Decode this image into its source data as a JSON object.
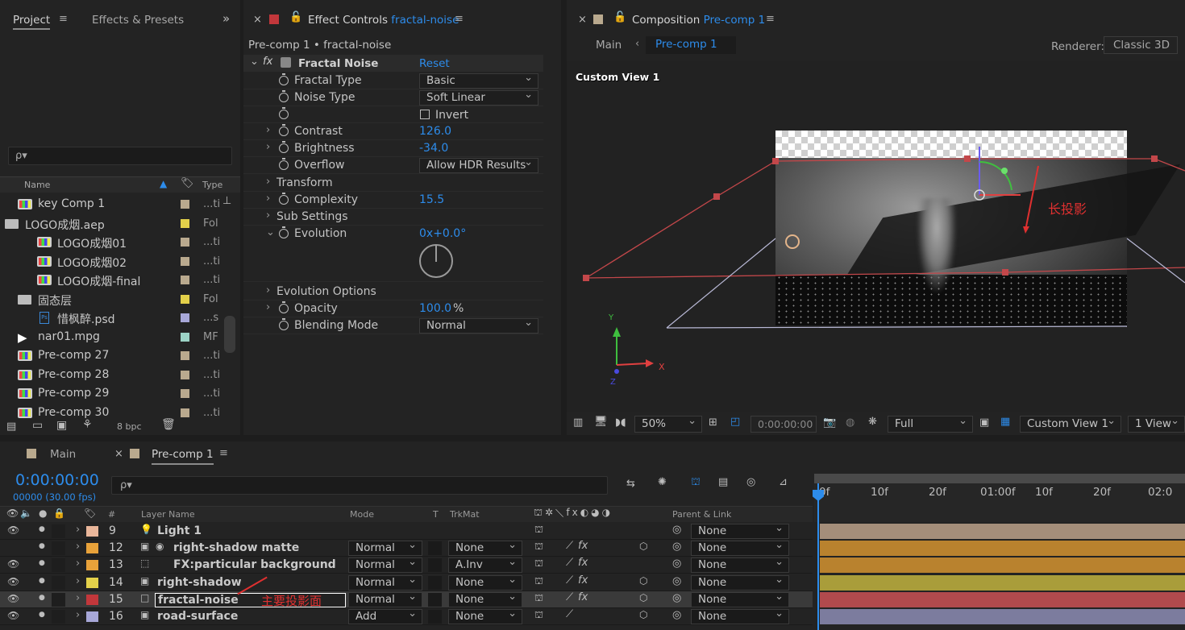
{
  "project": {
    "tabs": [
      "Project",
      "Effects & Presets"
    ],
    "search_placeholder": "ρ▾",
    "columns": {
      "name": "Name",
      "type": "Type"
    },
    "items": [
      {
        "name": "key Comp 1",
        "type": "...ti",
        "color": "#b9a98e",
        "icon": "comp"
      },
      {
        "name": "LOGO成烟.aep",
        "type": "Fol",
        "color": "#e3d04a",
        "icon": "folder"
      },
      {
        "name": "LOGO成烟01",
        "type": "...ti",
        "color": "#b9a98e",
        "icon": "comp"
      },
      {
        "name": "LOGO成烟02",
        "type": "...ti",
        "color": "#b9a98e",
        "icon": "comp"
      },
      {
        "name": "LOGO成烟-final",
        "type": "...ti",
        "color": "#b9a98e",
        "icon": "comp"
      },
      {
        "name": "固态层",
        "type": "Fol",
        "color": "#e3d04a",
        "icon": "folder"
      },
      {
        "name": "惜枫醉.psd",
        "type": "...s",
        "color": "#a7a7d8",
        "icon": "psd"
      },
      {
        "name": "nar01.mpg",
        "type": "MF",
        "color": "#9cd3c6",
        "icon": "video"
      },
      {
        "name": "Pre-comp 27",
        "type": "...ti",
        "color": "#b9a98e",
        "icon": "comp"
      },
      {
        "name": "Pre-comp 28",
        "type": "...ti",
        "color": "#b9a98e",
        "icon": "comp"
      },
      {
        "name": "Pre-comp 29",
        "type": "...ti",
        "color": "#b9a98e",
        "icon": "comp"
      },
      {
        "name": "Pre-comp 30",
        "type": "...ti",
        "color": "#b9a98e",
        "icon": "comp"
      }
    ],
    "bpc": "8 bpc"
  },
  "effect_controls": {
    "tab_label": "Effect Controls",
    "layer": "fractal-noise",
    "breadcrumb": "Pre-comp 1 • fractal-noise",
    "effect_name": "Fractal Noise",
    "reset": "Reset",
    "props": [
      {
        "label": "Fractal Type",
        "value": "Basic",
        "kind": "dropdown"
      },
      {
        "label": "Noise Type",
        "value": "Soft Linear",
        "kind": "dropdown"
      },
      {
        "label": "",
        "value": "Invert",
        "kind": "checkbox"
      },
      {
        "label": "Contrast",
        "value": "126.0",
        "kind": "number"
      },
      {
        "label": "Brightness",
        "value": "-34.0",
        "kind": "number"
      },
      {
        "label": "Overflow",
        "value": "Allow HDR Results",
        "kind": "dropdown"
      },
      {
        "label": "Transform",
        "value": "",
        "kind": "group"
      },
      {
        "label": "Complexity",
        "value": "15.5",
        "kind": "number"
      },
      {
        "label": "Sub Settings",
        "value": "",
        "kind": "group"
      },
      {
        "label": "Evolution",
        "value": "0x+0.0°",
        "kind": "number"
      },
      {
        "label": "Evolution Options",
        "value": "",
        "kind": "group"
      },
      {
        "label": "Opacity",
        "value": "100.0",
        "unit": "%",
        "kind": "number"
      },
      {
        "label": "Blending Mode",
        "value": "Normal",
        "kind": "dropdown"
      }
    ]
  },
  "composition": {
    "tab_label": "Composition",
    "comp": "Pre-comp 1",
    "crumbs": [
      "Main",
      "Pre-comp 1"
    ],
    "renderer_label": "Renderer:",
    "renderer": "Classic 3D",
    "view_label": "Custom View 1",
    "annotation": "长投影",
    "axis_x": "X",
    "axis_y": "Y",
    "axis_z": "Z",
    "footer": {
      "zoom": "50%",
      "timecode": "0:00:00:00",
      "resolution": "Full",
      "view": "Custom View 1",
      "layout": "1 View"
    }
  },
  "timeline": {
    "tabs": [
      "Main",
      "Pre-comp 1"
    ],
    "timecode": "0:00:00:00",
    "fps": "00000 (30.00 fps)",
    "search_placeholder": "ρ▾",
    "headers": {
      "num": "#",
      "layer_name": "Layer Name",
      "mode": "Mode",
      "t": "T",
      "trkmat": "TrkMat",
      "parent": "Parent & Link"
    },
    "ruler": [
      "0f",
      "10f",
      "20f",
      "01:00f",
      "10f",
      "20f",
      "02:0"
    ],
    "annotation": "主要投影面",
    "layers": [
      {
        "num": "9",
        "name": "Light 1",
        "mode": "",
        "trkmat": "",
        "parent": "None",
        "label": "#e9b69a",
        "bar": "#a48e7a",
        "eye": true
      },
      {
        "num": "12",
        "name": "right-shadow matte",
        "mode": "Normal",
        "trkmat": "None",
        "parent": "None",
        "label": "#e8a23a",
        "bar": "#b9822e",
        "eye": false
      },
      {
        "num": "13",
        "name": "FX:particular background",
        "mode": "Normal",
        "trkmat": "A.Inv",
        "parent": "None",
        "label": "#e8a23a",
        "bar": "#b9822e",
        "eye": true
      },
      {
        "num": "14",
        "name": "right-shadow",
        "mode": "Normal",
        "trkmat": "None",
        "parent": "None",
        "label": "#e3d04a",
        "bar": "#a99d3a",
        "eye": true
      },
      {
        "num": "15",
        "name": "fractal-noise",
        "mode": "Normal",
        "trkmat": "None",
        "parent": "None",
        "label": "#c2373b",
        "bar": "#b14a4d",
        "eye": true
      },
      {
        "num": "16",
        "name": "road-surface",
        "mode": "Add",
        "trkmat": "None",
        "parent": "None",
        "label": "#a7a7d8",
        "bar": "#7c7c9e",
        "eye": true
      }
    ]
  }
}
